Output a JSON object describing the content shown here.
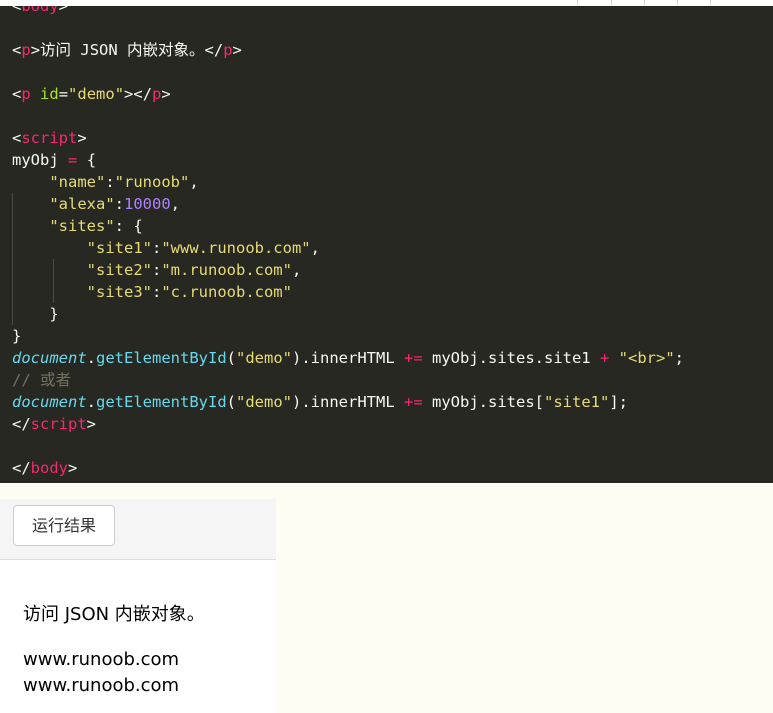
{
  "code_lines": {
    "l0_tag": "body",
    "l2_tag": "p",
    "l2_text": "访问 JSON 内嵌对象。",
    "l2_tag_close": "p",
    "l4_tag": "p",
    "l4_attr": "id",
    "l4_val": "\"demo\"",
    "l4_tag_close": "p",
    "l6_tag": "script",
    "l7_var": "myObj",
    "l7_op": "=",
    "l7_rest": " {",
    "l8_key": "\"name\"",
    "l8_val": "\"runoob\"",
    "l9_key": "\"alexa\"",
    "l9_val": "10000",
    "l10_key": "\"sites\"",
    "l11_key": "\"site1\"",
    "l11_val": "\"www.runoob.com\"",
    "l12_key": "\"site2\"",
    "l12_val": "\"m.runoob.com\"",
    "l13_key": "\"site3\"",
    "l13_val": "\"c.runoob.com\"",
    "l16_doc": "document",
    "l16_fn": "getElementById",
    "l16_arg": "\"demo\"",
    "l16_prop": ".innerHTML ",
    "l16_op": "+=",
    "l16_expr": " myObj.sites.site1 ",
    "l16_plus": "+",
    "l16_str": "\"<br>\"",
    "l17_comment": "// 或者",
    "l18_doc": "document",
    "l18_fn": "getElementById",
    "l18_arg": "\"demo\"",
    "l18_prop": ".innerHTML ",
    "l18_op": "+=",
    "l18_expr": " myObj.sites[",
    "l18_str": "\"site1\"",
    "l19_tag": "script",
    "l21_tag": "body"
  },
  "result": {
    "run_button": "运行结果",
    "paragraph": "访问 JSON 内嵌对象。",
    "demo_line_1": "www.runoob.com",
    "demo_line_2": "www.runoob.com"
  },
  "colors": {
    "editor_bg": "#272822",
    "tag": "#f92672",
    "attribute": "#a6e22e",
    "string": "#e6db74",
    "number": "#ae81ff",
    "function": "#66d9ef",
    "comment": "#75715e"
  }
}
